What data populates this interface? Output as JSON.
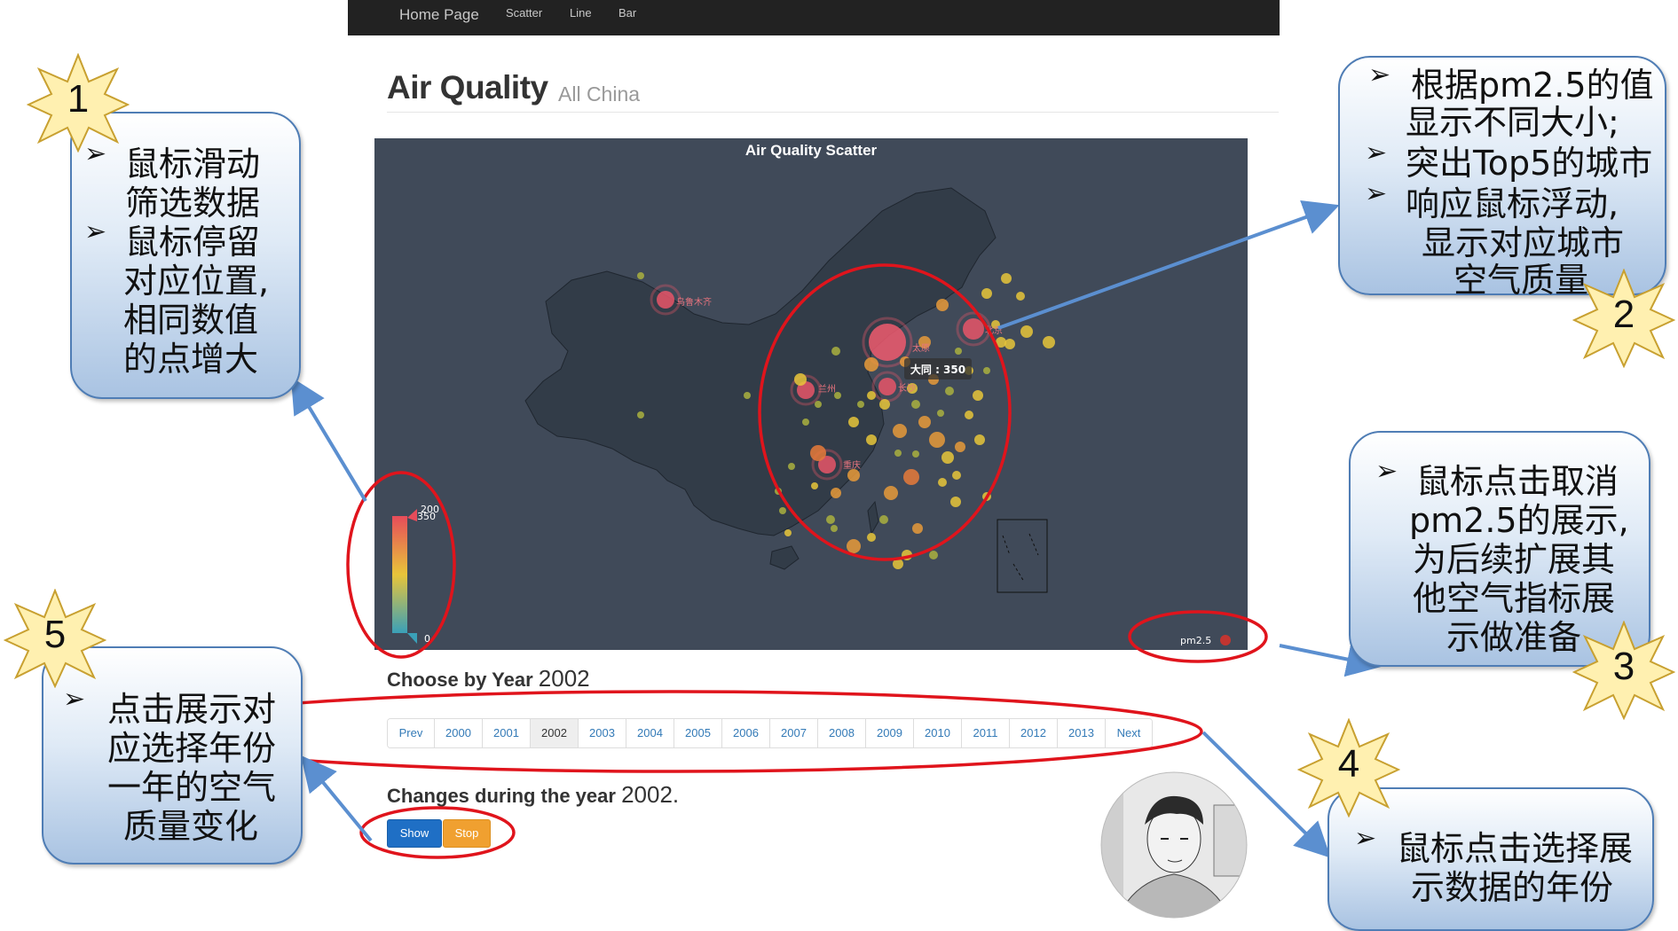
{
  "navbar": {
    "home": "Home Page",
    "items": [
      "Scatter",
      "Line",
      "Bar"
    ]
  },
  "header": {
    "title": "Air Quality",
    "subtitle": "All China"
  },
  "chart": {
    "title": "Air Quality Scatter",
    "tooltip": "大同 : 350",
    "visual_map": {
      "max_label": "200",
      "value_label": "350",
      "min_label": "0"
    },
    "legend": "pm2.5",
    "city_labels": [
      "乌鲁木齐",
      "兰州",
      "长沙",
      "重庆",
      "北京",
      "太原"
    ],
    "colors": {
      "background": "#404a59",
      "land": "#323c48",
      "high": "#e74c5a",
      "mid": "#e8c53a",
      "low": "#3aa0b8"
    }
  },
  "year_section": {
    "heading": "Choose by Year",
    "selected_year": "2002",
    "pages": [
      "Prev",
      "2000",
      "2001",
      "2002",
      "2003",
      "2004",
      "2005",
      "2006",
      "2007",
      "2008",
      "2009",
      "2010",
      "2011",
      "2012",
      "2013",
      "Next"
    ]
  },
  "changes_section": {
    "heading": "Changes during the year",
    "year": "2002.",
    "show_label": "Show",
    "stop_label": "Stop"
  },
  "annotations": [
    {
      "num": "1",
      "lines": [
        "鼠标滑动",
        "筛选数据",
        "鼠标停留",
        "对应位置,",
        "相同数值",
        "的点增大"
      ]
    },
    {
      "num": "2",
      "lines": [
        "根据pm2.5的值",
        "显示不同大小;",
        "突出Top5的城市",
        "响应鼠标浮动,",
        "显示对应城市",
        "空气质量"
      ]
    },
    {
      "num": "3",
      "lines": [
        "鼠标点击取消",
        "pm2.5的展示,",
        "为后续扩展其",
        "他空气指标展",
        "示做准备"
      ]
    },
    {
      "num": "4",
      "lines": [
        "鼠标点击选择展",
        "示数据的年份"
      ]
    },
    {
      "num": "5",
      "lines": [
        "点击展示对",
        "应选择年份",
        "一年的空气",
        "质量变化"
      ]
    }
  ]
}
